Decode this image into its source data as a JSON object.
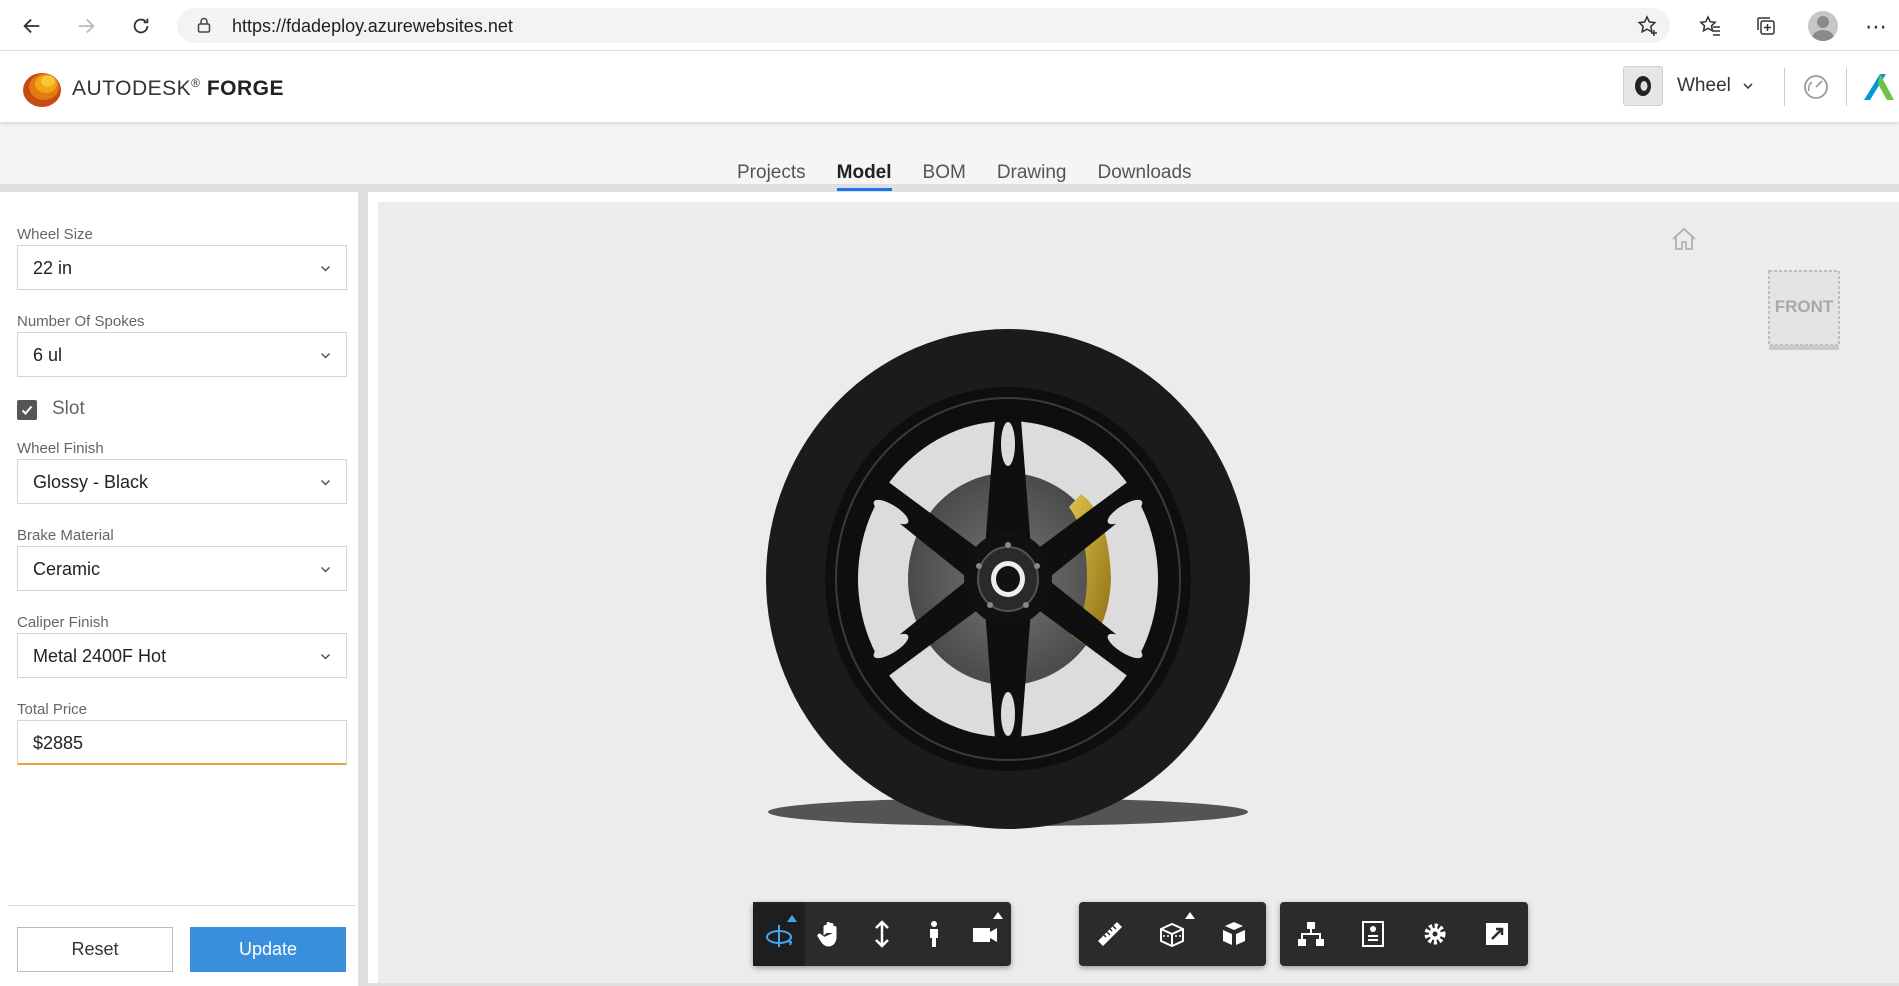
{
  "browser": {
    "url": "https://fdadeploy.azurewebsites.net"
  },
  "header": {
    "brand_prefix": "AUTODESK",
    "brand_reg": "®",
    "brand_product": "FORGE",
    "project_name": "Wheel"
  },
  "tabs": [
    {
      "label": "Projects",
      "active": false
    },
    {
      "label": "Model",
      "active": true
    },
    {
      "label": "BOM",
      "active": false
    },
    {
      "label": "Drawing",
      "active": false
    },
    {
      "label": "Downloads",
      "active": false
    }
  ],
  "params": {
    "wheel_size_label": "Wheel Size",
    "wheel_size_value": "22 in",
    "spokes_label": "Number Of Spokes",
    "spokes_value": "6 ul",
    "slot_label": "Slot",
    "slot_checked": true,
    "finish_label": "Wheel Finish",
    "finish_value": "Glossy - Black",
    "brake_label": "Brake Material",
    "brake_value": "Ceramic",
    "caliper_label": "Caliper Finish",
    "caliper_value": "Metal 2400F Hot",
    "price_label": "Total Price",
    "price_value": "$2885"
  },
  "buttons": {
    "reset": "Reset",
    "update": "Update"
  },
  "viewer": {
    "viewcube_face": "FRONT",
    "tools": [
      "orbit",
      "pan",
      "zoom",
      "first-person",
      "camera",
      "measure",
      "section",
      "explode",
      "model-browser",
      "properties",
      "settings",
      "fullscreen"
    ]
  },
  "colors": {
    "accent": "#3a8fdc",
    "active_tab_underline": "#1a73e8",
    "price_underline": "#e8a33d",
    "toolbar": "#2b2b2b",
    "caliper": "#c9a227"
  }
}
